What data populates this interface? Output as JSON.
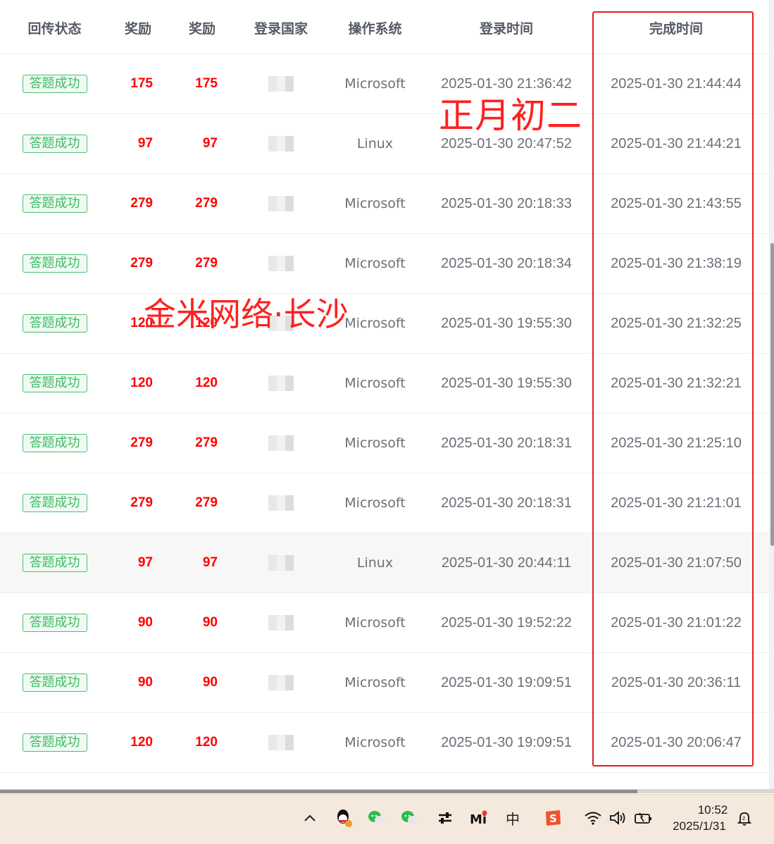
{
  "table": {
    "headers": [
      "回传状态",
      "奖励",
      "奖励",
      "登录国家",
      "操作系统",
      "登录时间",
      "完成时间"
    ],
    "rows": [
      {
        "status": "答题成功",
        "reward1": "175",
        "reward2": "175",
        "os": "Microsoft",
        "login_time": "2025-01-30 21:36:42",
        "done_time": "2025-01-30 21:44:44"
      },
      {
        "status": "答题成功",
        "reward1": "97",
        "reward2": "97",
        "os": "Linux",
        "login_time": "2025-01-30 20:47:52",
        "done_time": "2025-01-30 21:44:21"
      },
      {
        "status": "答题成功",
        "reward1": "279",
        "reward2": "279",
        "os": "Microsoft",
        "login_time": "2025-01-30 20:18:33",
        "done_time": "2025-01-30 21:43:55"
      },
      {
        "status": "答题成功",
        "reward1": "279",
        "reward2": "279",
        "os": "Microsoft",
        "login_time": "2025-01-30 20:18:34",
        "done_time": "2025-01-30 21:38:19"
      },
      {
        "status": "答题成功",
        "reward1": "120",
        "reward2": "120",
        "os": "Microsoft",
        "login_time": "2025-01-30 19:55:30",
        "done_time": "2025-01-30 21:32:25"
      },
      {
        "status": "答题成功",
        "reward1": "120",
        "reward2": "120",
        "os": "Microsoft",
        "login_time": "2025-01-30 19:55:30",
        "done_time": "2025-01-30 21:32:21"
      },
      {
        "status": "答题成功",
        "reward1": "279",
        "reward2": "279",
        "os": "Microsoft",
        "login_time": "2025-01-30 20:18:31",
        "done_time": "2025-01-30 21:25:10"
      },
      {
        "status": "答题成功",
        "reward1": "279",
        "reward2": "279",
        "os": "Microsoft",
        "login_time": "2025-01-30 20:18:31",
        "done_time": "2025-01-30 21:21:01"
      },
      {
        "status": "答题成功",
        "reward1": "97",
        "reward2": "97",
        "os": "Linux",
        "login_time": "2025-01-30 20:44:11",
        "done_time": "2025-01-30 21:07:50"
      },
      {
        "status": "答题成功",
        "reward1": "90",
        "reward2": "90",
        "os": "Microsoft",
        "login_time": "2025-01-30 19:52:22",
        "done_time": "2025-01-30 21:01:22"
      },
      {
        "status": "答题成功",
        "reward1": "90",
        "reward2": "90",
        "os": "Microsoft",
        "login_time": "2025-01-30 19:09:51",
        "done_time": "2025-01-30 20:36:11"
      },
      {
        "status": "答题成功",
        "reward1": "120",
        "reward2": "120",
        "os": "Microsoft",
        "login_time": "2025-01-30 19:09:51",
        "done_time": "2025-01-30 20:06:47"
      }
    ]
  },
  "annotations": {
    "text1": "正月初二",
    "text2": "金米网络·长沙"
  },
  "colors": {
    "reward": "#ff0000",
    "status_tag": "#3dbb63",
    "highlight_box": "#e02020",
    "taskbar_bg": "#f5e9dd"
  },
  "taskbar": {
    "icons": [
      "chevron-up-icon",
      "qq-icon",
      "wechat-icon",
      "wechat-icon",
      "settings-sliders-icon",
      "mi-icon",
      "input-method-icon",
      "sogou-icon",
      "wifi-icon",
      "volume-icon",
      "battery-icon",
      "notification-icon"
    ],
    "ime_label": "中",
    "time": "10:52",
    "date": "2025/1/31"
  }
}
